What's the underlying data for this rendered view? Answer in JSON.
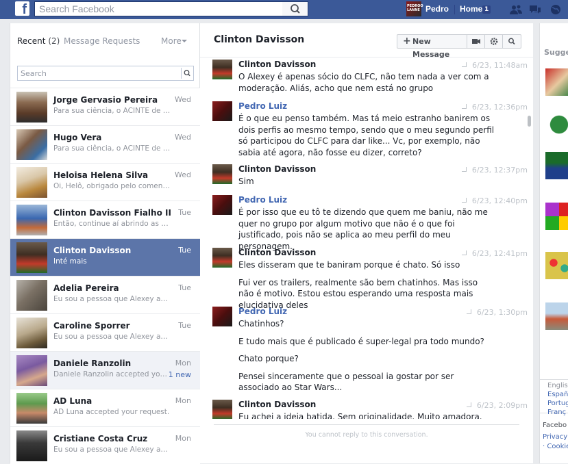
{
  "topbar": {
    "logo": "f",
    "search_placeholder": "Search Facebook",
    "user_name": "Pedro",
    "user_avatar_text": "PEDROO LANNE",
    "home_label": "Home",
    "home_count": "1",
    "icons": [
      "friends-icon",
      "messages-icon",
      "globe-icon"
    ]
  },
  "left": {
    "tab_recent": "Recent",
    "tab_recent_count": "(2)",
    "tab_requests": "Message Requests",
    "tab_more": "More",
    "search_placeholder": "Search",
    "threads": [
      {
        "name": "Jorge Gervasio Pereira",
        "snippet": "Para sua ciência, o ACINTE de Cl...",
        "time": "Wed"
      },
      {
        "name": "Hugo Vera",
        "snippet": "Para sua ciência, o ACINTE de Cl...",
        "time": "Wed"
      },
      {
        "name": "Heloisa Helena Silva",
        "snippet": "Oi, Helô, obrigado pelo comentári...",
        "time": "Wed"
      },
      {
        "name": "Clinton Davisson Fialho II",
        "snippet": "Então, continue aí abrindo as pern...",
        "time": "Tue"
      },
      {
        "name": "Clinton Davisson",
        "snippet": "Inté mais",
        "time": "Tue"
      },
      {
        "name": "Adelia Pereira",
        "snippet": "Eu sou a pessoa que Alexey acus...",
        "time": "Tue"
      },
      {
        "name": "Caroline Sporrer",
        "snippet": "Eu sou a pessoa que Alexey acus...",
        "time": "Tue"
      },
      {
        "name": "Daniele Ranzolin",
        "snippet": "Daniele Ranzolin accepted your r...",
        "time": "Mon",
        "badge": "1 new"
      },
      {
        "name": "AD Luna",
        "snippet": "AD Luna accepted your request.",
        "time": "Mon"
      },
      {
        "name": "Cristiane Costa Cruz",
        "snippet": "Eu sou a pessoa que Alexey acus...",
        "time": "Mon"
      }
    ]
  },
  "conversation": {
    "title": "Clinton Davisson",
    "new_message_label": "New Message",
    "toolbar_icons": [
      "video-icon",
      "gear-icon",
      "search-icon"
    ],
    "messages": [
      {
        "sender": "Clinton Davisson",
        "time": "6/23, 11:48am",
        "lines": [
          "O Alexey é apenas sócio do CLFC, não tem nada a ver com a moderação. Aliás, acho que nem está no grupo"
        ]
      },
      {
        "sender": "Pedro Luiz",
        "time": "6/23, 12:36pm",
        "lines": [
          "É o que eu penso também. Mas tá meio estranho banirem os dois perfis ao mesmo tempo, sendo que o meu segundo perfil só participou do CLFC para dar like... Vc, por exemplo, não sabia até agora, não fosse eu dizer, correto?"
        ]
      },
      {
        "sender": "Clinton Davisson",
        "time": "6/23, 12:37pm",
        "lines": [
          "Sim"
        ]
      },
      {
        "sender": "Pedro Luiz",
        "time": "6/23, 12:40pm",
        "lines": [
          "É por isso que eu tô te dizendo que quem me baniu, não me quer no grupo por algum motivo que não é o que foi justificado, pois não se aplica ao meu perfil do meu personagem."
        ]
      },
      {
        "sender": "Clinton Davisson",
        "time": "6/23, 12:41pm",
        "lines": [
          "Eles disseram que te baniram porque é chato. Só isso",
          "Fui ver os trailers, realmente são bem chatinhos. Mas isso não é motivo. Estou estou esperando uma resposta mais elucidativa deles"
        ]
      },
      {
        "sender": "Pedro Luiz",
        "time": "6/23, 1:30pm",
        "lines": [
          "Chatinhos?",
          "E tudo mais que é publicado é super-legal pra todo mundo?",
          "Chato porque?",
          "Pensei sinceramente que o pessoal ia gostar por ser associado ao Star Wars..."
        ]
      },
      {
        "sender": "Clinton Davisson",
        "time": "6/23, 2:09pm",
        "lines": [
          "Eu achei a ideia batida. Sem originalidade. Muito amadora. Você"
        ]
      }
    ],
    "reply_note": "You cannot reply to this conversation."
  },
  "right": {
    "suggested": "Sugges",
    "languages": [
      "English",
      "Españ",
      "Portug",
      "Franç"
    ],
    "footer": [
      "Facebo",
      "Privacy",
      "· Cookie"
    ]
  }
}
